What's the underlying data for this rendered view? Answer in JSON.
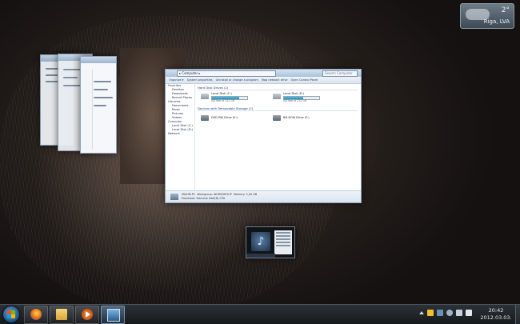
{
  "weather": {
    "temperature": "2°",
    "location": "Riga, LVA"
  },
  "explorer": {
    "address": "▸ Computer ▸",
    "search_placeholder": "Search Computer",
    "toolbar": [
      "Organize ▾",
      "System properties",
      "Uninstall or change a program",
      "Map network drive",
      "Open Control Panel"
    ],
    "nav": [
      {
        "label": "Favorites",
        "header": true
      },
      {
        "label": "Desktop",
        "header": false
      },
      {
        "label": "Downloads",
        "header": false
      },
      {
        "label": "Recent Places",
        "header": false
      },
      {
        "label": "Libraries",
        "header": true
      },
      {
        "label": "Documents",
        "header": false
      },
      {
        "label": "Music",
        "header": false
      },
      {
        "label": "Pictures",
        "header": false
      },
      {
        "label": "Videos",
        "header": false
      },
      {
        "label": "Computer",
        "header": true
      },
      {
        "label": "Local Disk (C:)",
        "header": false
      },
      {
        "label": "Local Disk (D:)",
        "header": false
      },
      {
        "label": "Network",
        "header": true
      }
    ],
    "section_hdd": "Hard Disk Drives (2)",
    "section_removable": "Devices with Removable Storage (2)",
    "drives": [
      {
        "name": "Local Disk (C:)",
        "free": "GB free of 232 GB",
        "fill": 0.78
      },
      {
        "name": "Local Disk (D:)",
        "free": "GB free of 232 GB",
        "fill": 0.55
      }
    ],
    "removable": [
      {
        "name": "DVD RW Drive (E:)"
      },
      {
        "name": "BD-ROM Drive (F:)"
      }
    ],
    "details": {
      "name": "MAXIM-PC",
      "workgroup": "Workgroup: WORKGROUP",
      "processor": "Processor: Genuine Intel(R) CPU",
      "memory": "Memory: 2,00 GB"
    }
  },
  "clock": {
    "time": "20:42",
    "date": "2012.03.03."
  },
  "taskbar_items": [
    "firefox-icon",
    "explorer-folder-icon",
    "media-player-icon",
    "monitor-icon"
  ]
}
